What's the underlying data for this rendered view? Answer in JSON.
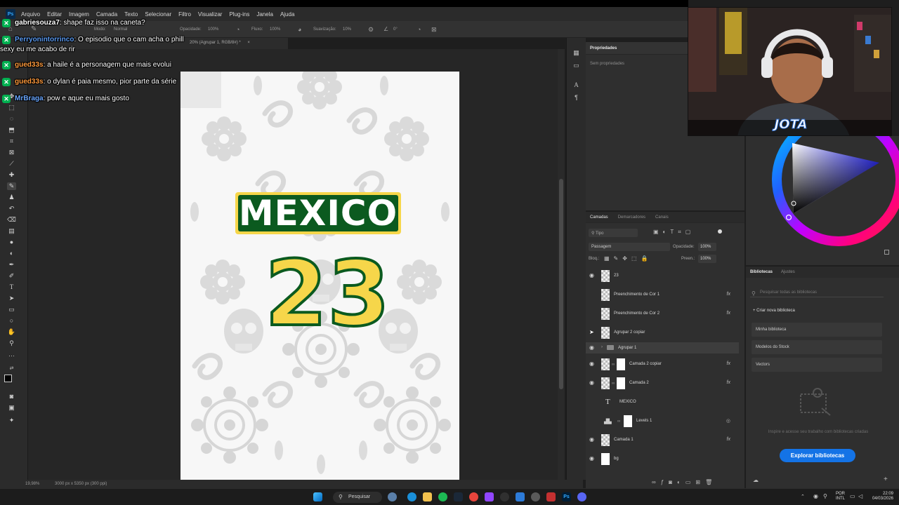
{
  "menu": {
    "app_icon": "Ps",
    "items": [
      "Arquivo",
      "Editar",
      "Imagem",
      "Camada",
      "Texto",
      "Selecionar",
      "Filtro",
      "Visualizar",
      "Plug-ins",
      "Janela",
      "Ajuda"
    ]
  },
  "options_bar": {
    "mode_label": "Modo:",
    "mode_value": "Normal",
    "opacity_label": "Opacidade:",
    "opacity_value": "100%",
    "flow_label": "Fluxo:",
    "flow_value": "100%",
    "smoothing_label": "Suavização:",
    "smoothing_value": "10%",
    "angle_value": "0°"
  },
  "document_tab": {
    "title": "20% (Agrupar 1, RGB/8#) *",
    "close": "×"
  },
  "artwork": {
    "title_text": "MEXICO",
    "number_text": "23",
    "colors": {
      "green": "#0b5a1f",
      "yellow": "#f6d64a",
      "pattern": "#d8d8d8"
    }
  },
  "status": {
    "zoom": "19,98%",
    "doc_size": "3000 px x 5350 px (300 ppi)"
  },
  "properties": {
    "title": "Propriedades",
    "subtitle": "Sem propriedades"
  },
  "layers_panel": {
    "tabs": [
      "Camadas",
      "Demarcadores",
      "Canais"
    ],
    "filter_label": "Tipo",
    "blend_mode": "Passagem",
    "opacity_label": "Opacidade:",
    "opacity_value": "100%",
    "lock_label": "Bloq.:",
    "fill_label": "Preen.:",
    "fill_value": "100%",
    "layers": [
      {
        "name": "23",
        "visible": true,
        "fx": false
      },
      {
        "name": "Preenchimento de Cor 1",
        "visible": false,
        "fx": true
      },
      {
        "name": "Preenchimento de Cor 2",
        "visible": false,
        "fx": true
      },
      {
        "name": "Agrupar 2 copiar",
        "visible": false,
        "fx": false
      },
      {
        "name": "Agrupar 1",
        "visible": true,
        "fx": false,
        "selected": true
      },
      {
        "name": "Camada 2 copiar",
        "visible": true,
        "fx": true
      },
      {
        "name": "Camada 2",
        "visible": true,
        "fx": true
      },
      {
        "name": "MEXICO",
        "visible": false,
        "fx": false
      },
      {
        "name": "Levels 1",
        "visible": false,
        "fx": false
      },
      {
        "name": "Camada 1",
        "visible": true,
        "fx": true
      },
      {
        "name": "bg",
        "visible": true,
        "fx": false
      }
    ],
    "fx_label": "fx"
  },
  "libraries": {
    "tabs": [
      "Bibliotecas",
      "Ajustes"
    ],
    "search_placeholder": "Pesquisar todas as bibliotecas",
    "create_label": "+ Criar nova biblioteca",
    "items": [
      "Minha biblioteca",
      "Modelos do Stock",
      "Vectors"
    ],
    "empty_text": "Inspire e acesse seu trabalho com bibliotecas criadas",
    "explore_button": "Explorar bibliotecas"
  },
  "webcam": {
    "overlay_logo": "JOTA"
  },
  "chat": [
    {
      "user": "gabriesouza7",
      "color": "#ffffff",
      "message": "shape faz isso na caneta?"
    },
    {
      "user": "Perryonintorrinco",
      "color": "#5b9bf2",
      "message": "O episodio que o cam acha o phill",
      "cont": "sexy eu me acabo de rir"
    },
    {
      "user": "gued33s",
      "color": "#ff9a3c",
      "message": "a haile é a personagem que mais evolui"
    },
    {
      "user": "gued33s",
      "color": "#ff9a3c",
      "message": "o dylan é paia mesmo, pior parte da série"
    },
    {
      "user": "MrBraga",
      "color": "#6aa7ff",
      "message": "pow e aque eu mais gosto"
    }
  ],
  "taskbar": {
    "search_label": "Pesquisar",
    "lang": "POR",
    "lang2": "INTL",
    "time": "22:09",
    "date": "04/03/2026"
  }
}
